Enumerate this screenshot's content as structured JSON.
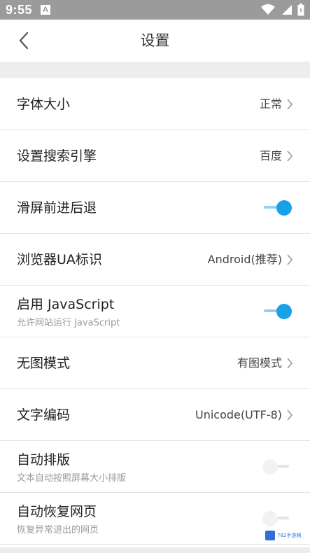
{
  "status_bar": {
    "time": "9:55",
    "badge": "A",
    "icons": [
      "wifi-icon",
      "signal-icon",
      "battery-icon"
    ]
  },
  "header": {
    "back_icon": "chevron-left-icon",
    "title": "设置"
  },
  "settings": [
    {
      "label": "字体大小",
      "value": "正常",
      "control": "chevron"
    },
    {
      "label": "设置搜索引擎",
      "value": "百度",
      "control": "chevron"
    },
    {
      "label": "滑屏前进后退",
      "control": "toggle",
      "on": true
    },
    {
      "label": "浏览器UA标识",
      "value": "Android(推荐)",
      "control": "chevron"
    },
    {
      "label": "启用 JavaScript",
      "sub": "允许网站运行 JavaScript",
      "control": "toggle",
      "on": true
    },
    {
      "label": "无图模式",
      "value": "有图模式",
      "control": "chevron"
    },
    {
      "label": "文字编码",
      "value": "Unicode(UTF-8)",
      "control": "chevron"
    },
    {
      "label": "自动排版",
      "sub": "文本自动按照屏幕大小排版",
      "control": "toggle",
      "on": false
    },
    {
      "label": "自动恢复网页",
      "sub": "恢复异常退出的网页",
      "control": "toggle",
      "on": false
    }
  ],
  "watermark": {
    "text": "782手游网"
  },
  "colors": {
    "accent": "#17a2e8",
    "accent_track": "#8fd0f0",
    "status_bar": "#9b9b9b",
    "divider": "#e2e2e2"
  }
}
